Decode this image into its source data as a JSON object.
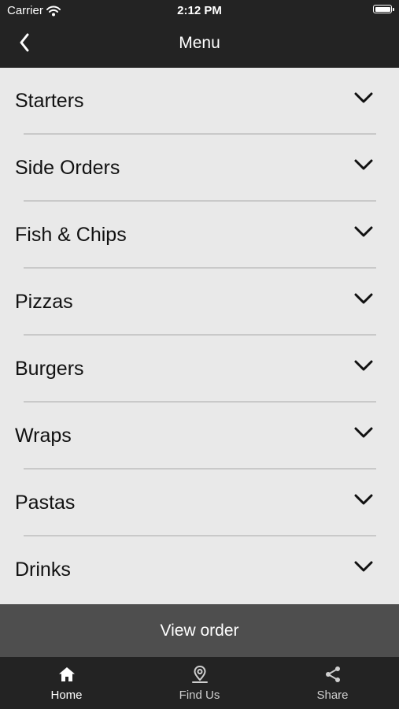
{
  "status_bar": {
    "carrier": "Carrier",
    "time": "2:12 PM"
  },
  "nav": {
    "title": "Menu",
    "back_icon": "chevron-left-icon"
  },
  "menu": {
    "items": [
      {
        "label": "Starters"
      },
      {
        "label": "Side Orders"
      },
      {
        "label": "Fish & Chips"
      },
      {
        "label": "Pizzas"
      },
      {
        "label": "Burgers"
      },
      {
        "label": "Wraps"
      },
      {
        "label": "Pastas"
      },
      {
        "label": "Drinks"
      }
    ],
    "expand_icon": "chevron-down-icon"
  },
  "view_order": {
    "label": "View order"
  },
  "tab_bar": {
    "tabs": [
      {
        "label": "Home",
        "icon": "home-icon",
        "active": true
      },
      {
        "label": "Find Us",
        "icon": "map-pin-icon",
        "active": false
      },
      {
        "label": "Share",
        "icon": "share-icon",
        "active": false
      }
    ]
  },
  "colors": {
    "bar_background": "#232323",
    "list_background": "#e9e9e9",
    "button_background": "#4e4e4e",
    "divider": "#c9c9c9"
  }
}
